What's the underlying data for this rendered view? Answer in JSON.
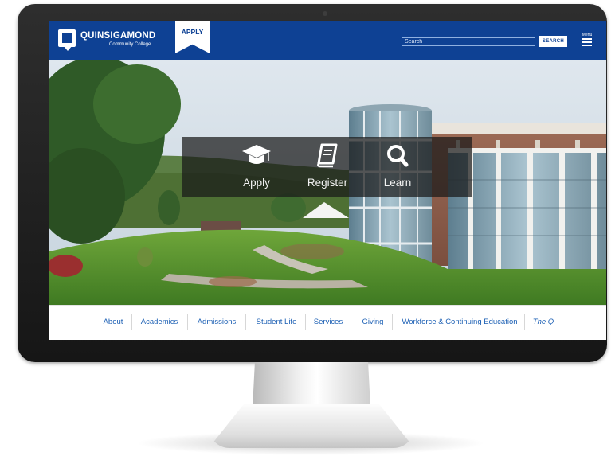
{
  "header": {
    "logo_name": "QUINSIGAMOND",
    "logo_sub": "Community College",
    "apply_label": "APPLY",
    "search_placeholder": "Search",
    "search_button": "SEARCH",
    "menu_label": "Menu"
  },
  "quick_links": [
    {
      "label": "Apply",
      "icon": "graduation-cap-icon"
    },
    {
      "label": "Register",
      "icon": "book-icon"
    },
    {
      "label": "Learn",
      "icon": "search-icon"
    }
  ],
  "nav": {
    "items": [
      {
        "label": "About"
      },
      {
        "label": "Academics"
      },
      {
        "label": "Admissions"
      },
      {
        "label": "Student Life"
      },
      {
        "label": "Services"
      },
      {
        "label": "Giving"
      },
      {
        "label": "Workforce & Continuing Education"
      },
      {
        "label": "The Q"
      }
    ]
  },
  "colors": {
    "brand_blue": "#0e4194",
    "nav_link": "#1b5fb4"
  }
}
